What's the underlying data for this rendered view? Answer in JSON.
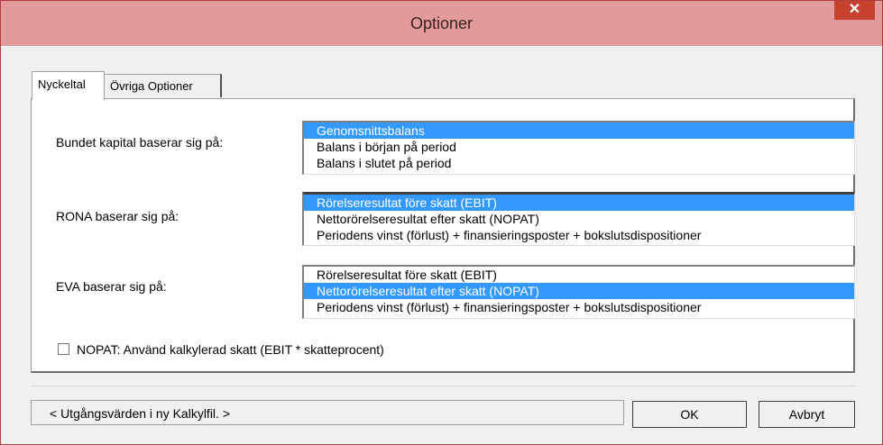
{
  "window": {
    "title": "Optioner",
    "close_label": "✕",
    "accent_color": "#e29a9a"
  },
  "tabs": [
    {
      "label": "Nyckeltal",
      "active": true
    },
    {
      "label": "Övriga Optioner",
      "active": false
    }
  ],
  "sections": [
    {
      "label": "Bundet kapital baserar sig på:",
      "options": [
        "Genomsnittsbalans",
        "Balans i början på period",
        "Balans i slutet på period"
      ],
      "selected_index": 0
    },
    {
      "label": "RONA baserar sig på:",
      "options": [
        "Rörelseresultat före skatt (EBIT)",
        "Nettorörelseresultat efter skatt (NOPAT)",
        "Periodens vinst (förlust) + finansieringsposter + bokslutsdispositioner"
      ],
      "selected_index": 0
    },
    {
      "label": "EVA baserar sig på:",
      "options": [
        "Rörelseresultat före skatt (EBIT)",
        "Nettorörelseresultat efter skatt (NOPAT)",
        "Periodens vinst (förlust) + finansieringsposter + bokslutsdispositioner"
      ],
      "selected_index": 1
    }
  ],
  "checkbox": {
    "label": "NOPAT: Använd kalkylerad skatt (EBIT * skatteprocent)",
    "checked": false
  },
  "status_text": "< Utgångsvärden i ny Kalkylfil. >",
  "buttons": {
    "ok_label": "OK",
    "cancel_label": "Avbryt"
  }
}
